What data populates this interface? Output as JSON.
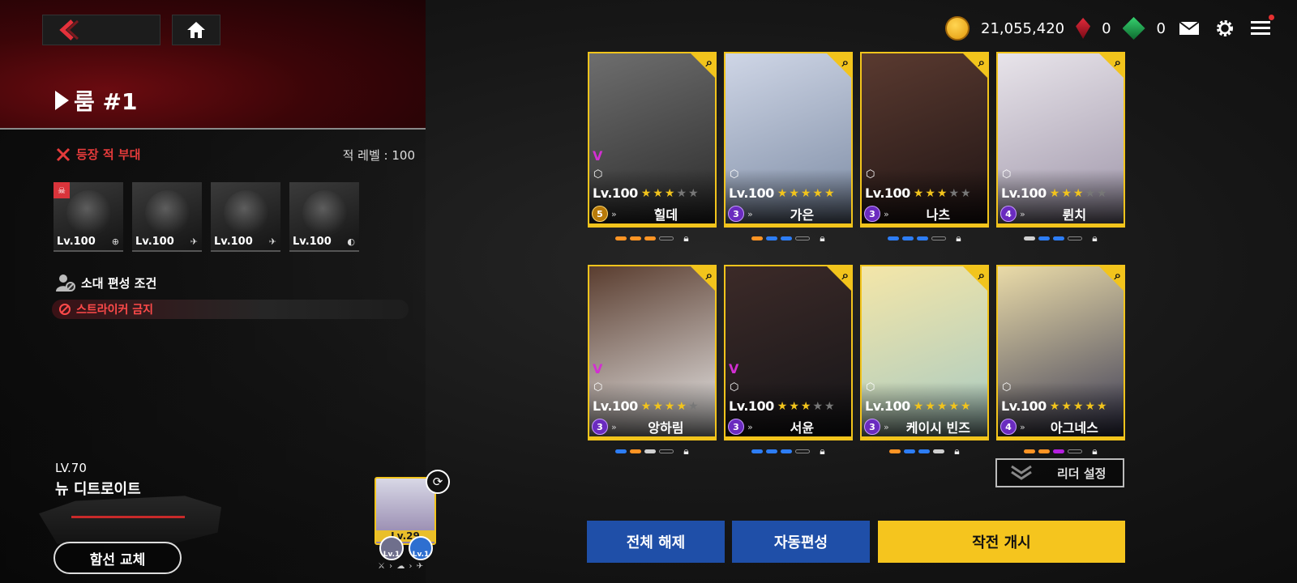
{
  "topbar": {
    "gold": "21,055,420",
    "red_crystal": "0",
    "green_crystal": "0",
    "icons": [
      "coin-icon",
      "red-crystal-icon",
      "green-crystal-icon",
      "mail-icon",
      "gear-icon",
      "menu-icon"
    ]
  },
  "room": {
    "title": "룸 #1"
  },
  "enemy": {
    "section_label": "등장 적 부대",
    "level_label": "적 레벨 : 100",
    "units": [
      {
        "level": "Lv.100",
        "type_icon": "crosshair-icon"
      },
      {
        "level": "Lv.100",
        "type_icon": "wing-icon"
      },
      {
        "level": "Lv.100",
        "type_icon": "wing-icon"
      },
      {
        "level": "Lv.100",
        "type_icon": "shield-icon"
      }
    ]
  },
  "condition": {
    "label": "소대 편성 조건",
    "rule": "스트라이커 금지"
  },
  "ship": {
    "level": "LV.70",
    "name": "뉴 디트로이트",
    "change_label": "함선 교체"
  },
  "leader": {
    "level": "Lv.29",
    "sub1_level": "Lv.1",
    "sub2_level": "Lv.1",
    "sub_row": "⚔ › ☁ › ✈"
  },
  "cards": [
    {
      "level": "Lv.100",
      "rank": "5",
      "name": "힐데",
      "stars": 3,
      "vmark": "V",
      "class_icon": "hex-icon",
      "colors": [
        "#6e6e6e",
        "#2a2a2a"
      ],
      "pips": [
        "orange",
        "orange",
        "orange",
        "ring"
      ]
    },
    {
      "level": "Lv.100",
      "rank": "3",
      "name": "가은",
      "stars": 5,
      "vmark": "",
      "class_icon": "hex-icon",
      "colors": [
        "#cfd6e6",
        "#7b8aa3"
      ],
      "pips": [
        "orange",
        "blue",
        "blue",
        "ring"
      ]
    },
    {
      "level": "Lv.100",
      "rank": "3",
      "name": "나츠",
      "stars": 3,
      "vmark": "",
      "class_icon": "hex-icon",
      "colors": [
        "#5a3a30",
        "#1f1414"
      ],
      "pips": [
        "blue",
        "blue",
        "blue",
        "ring"
      ]
    },
    {
      "level": "Lv.100",
      "rank": "4",
      "name": "륀치",
      "stars": 3,
      "vmark": "",
      "class_icon": "hex-icon",
      "colors": [
        "#e8e4ea",
        "#9d94a8"
      ],
      "pips": [
        "white",
        "blue",
        "blue",
        "ring"
      ]
    },
    {
      "level": "Lv.100",
      "rank": "3",
      "name": "앙하림",
      "stars": 4,
      "vmark": "V",
      "class_icon": "hex-icon",
      "colors": [
        "#5a3d2f",
        "#ececec"
      ],
      "pips": [
        "blue",
        "orange",
        "white",
        "ring"
      ]
    },
    {
      "level": "Lv.100",
      "rank": "3",
      "name": "서윤",
      "stars": 3,
      "vmark": "V",
      "class_icon": "hex-icon",
      "colors": [
        "#3c2a28",
        "#151518"
      ],
      "pips": [
        "blue",
        "blue",
        "blue",
        "ring"
      ]
    },
    {
      "level": "Lv.100",
      "rank": "3",
      "name": "케이시 빈즈",
      "stars": 5,
      "vmark": "",
      "class_icon": "hex-icon",
      "colors": [
        "#f4e6a8",
        "#a6c9c3"
      ],
      "pips": [
        "orange",
        "blue",
        "blue",
        "white"
      ]
    },
    {
      "level": "Lv.100",
      "rank": "4",
      "name": "아그네스",
      "stars": 5,
      "vmark": "",
      "class_icon": "crosshair-icon",
      "colors": [
        "#eadba8",
        "#3a3a55"
      ],
      "pips": [
        "orange",
        "orange",
        "purple",
        "ring"
      ]
    }
  ],
  "buttons": {
    "leader_set": "리더 설정",
    "release_all": "전체 해제",
    "auto_form": "자동편성",
    "start": "작전 개시"
  }
}
